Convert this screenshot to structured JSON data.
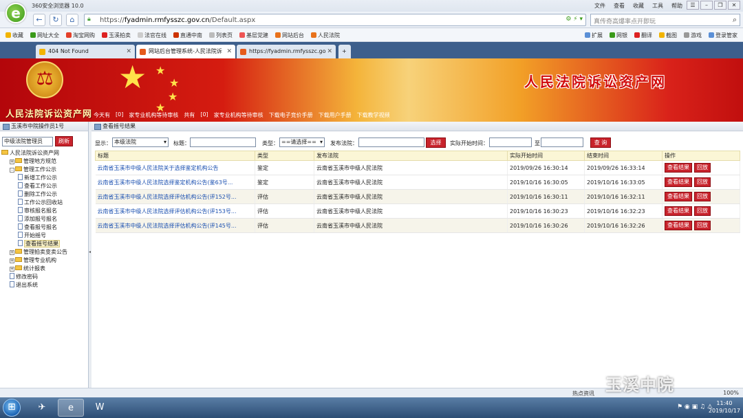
{
  "browser": {
    "app_title": "360安全浏览器 10.0",
    "menus": [
      "文件",
      "查看",
      "收藏",
      "工具",
      "帮助"
    ],
    "url_prefix": "https://",
    "url_domain": "fyadmin.rmfysszc.gov.cn",
    "url_path": "/Default.aspx",
    "search_placeholder": "真传奇高爆率点开即玩",
    "favorites": [
      "收藏",
      "网址大全",
      "淘宝网购",
      "玉溪拍卖",
      "法官在线",
      "直通中南",
      "列表页",
      "基层党建",
      "网站后台",
      "人民法院"
    ],
    "favorites_right": [
      "扩展",
      "网银",
      "翻译",
      "截图",
      "游戏",
      "登录管家"
    ],
    "tabs": [
      {
        "label": "404 Not Found"
      },
      {
        "label": "网站后台管理系统-人民法院诉"
      },
      {
        "label": "https://fyadmin.rmfysszc.go"
      }
    ]
  },
  "banner": {
    "site_name": "人民法院诉讼资产网",
    "title": "人民法院诉讼资产网",
    "links": [
      "今天有",
      "[0]",
      "家专业机构等待审核",
      "共有",
      "[0]",
      "家专业机构等待审核",
      "下载电子竞价手册",
      "下载用户手册",
      "下载教学视频"
    ]
  },
  "left": {
    "header": "玉溪市中院操作员1号",
    "select_value": "中级法院管理员",
    "refresh_label": "刷新",
    "tree": [
      {
        "label": "人民法院诉讼资产网",
        "kind": "root",
        "level": 0
      },
      {
        "label": "管理地方规范",
        "kind": "folder",
        "level": 1,
        "pm": "+"
      },
      {
        "label": "管理工作公示",
        "kind": "folder",
        "level": 1,
        "pm": "-"
      },
      {
        "label": "新增工作公示",
        "kind": "doc",
        "level": 2
      },
      {
        "label": "查看工作公示",
        "kind": "doc",
        "level": 2
      },
      {
        "label": "删除工作公示",
        "kind": "doc",
        "level": 2
      },
      {
        "label": "工作公示回收站",
        "kind": "doc",
        "level": 2
      },
      {
        "label": "审核报名报名",
        "kind": "doc",
        "level": 2
      },
      {
        "label": "添加报号报名",
        "kind": "doc",
        "level": 2
      },
      {
        "label": "查看报号报名",
        "kind": "doc",
        "level": 2
      },
      {
        "label": "开始摇号",
        "kind": "doc",
        "level": 2
      },
      {
        "label": "查看摇号结果",
        "kind": "doc",
        "level": 2,
        "selected": true
      },
      {
        "label": "管理拍卖变卖公告",
        "kind": "folder",
        "level": 1,
        "pm": "+"
      },
      {
        "label": "管理专业机构",
        "kind": "folder",
        "level": 1,
        "pm": "+"
      },
      {
        "label": "统计报表",
        "kind": "folder",
        "level": 1,
        "pm": "+"
      },
      {
        "label": "修改密码",
        "kind": "doc",
        "level": 1
      },
      {
        "label": "退出系统",
        "kind": "doc",
        "level": 1
      }
    ]
  },
  "content": {
    "header": "查看摇号结果",
    "filter": {
      "display_label": "显示：",
      "display_value": "本级法院",
      "title_label": "标题：",
      "type_label": "类型：",
      "type_value": "==请选择==",
      "court_label": "发布法院：",
      "choose_label": "选择",
      "start_label": "实际开始时间：",
      "to_label": "至",
      "query_label": "查 询"
    },
    "columns": [
      "标题",
      "类型",
      "发布法院",
      "实际开始时间",
      "结束时间",
      "操作"
    ],
    "rows": [
      {
        "title": "云南省玉溪市中级人民法院关于选择鉴定机构公告",
        "type": "鉴定",
        "court": "云南省玉溪市中级人民法院",
        "start": "2019/09/26 16:30:14",
        "end": "2019/09/26 16:33:14"
      },
      {
        "title": "云南省玉溪市中级人民法院选择鉴定机构公告(鉴63号...",
        "type": "鉴定",
        "court": "云南省玉溪市中级人民法院",
        "start": "2019/10/16 16:30:05",
        "end": "2019/10/16 16:33:05"
      },
      {
        "title": "云南省玉溪市中级人民法院选择评估机构公告(评152号...",
        "type": "评估",
        "court": "云南省玉溪市中级人民法院",
        "start": "2019/10/16 16:30:11",
        "end": "2019/10/16 16:32:11"
      },
      {
        "title": "云南省玉溪市中级人民法院选择评估机构公告(评153号...",
        "type": "评估",
        "court": "云南省玉溪市中级人民法院",
        "start": "2019/10/16 16:30:23",
        "end": "2019/10/16 16:32:23"
      },
      {
        "title": "云南省玉溪市中级人民法院选择评估机构公告(评145号...",
        "type": "评估",
        "court": "云南省玉溪市中级人民法院",
        "start": "2019/10/16 16:30:26",
        "end": "2019/10/16 16:32:26"
      }
    ],
    "action_view": "查看结果",
    "action_playback": "回放"
  },
  "statusbar": {
    "hot": "热点资讯",
    "zoom": "100%"
  },
  "taskbar": {
    "time": "11:40",
    "date": "2019/10/17"
  },
  "watermark": "玉溪中院"
}
